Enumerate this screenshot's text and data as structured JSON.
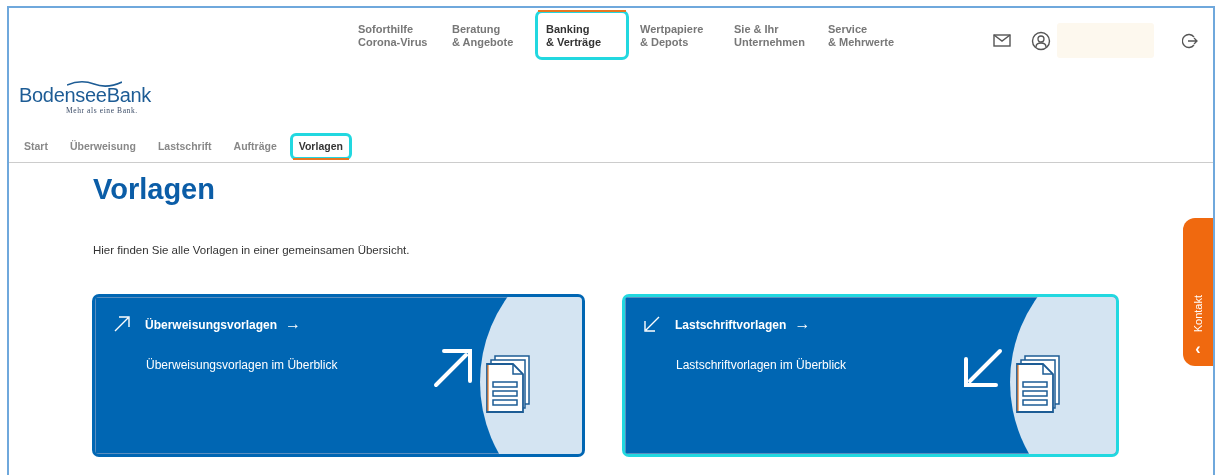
{
  "top_nav": [
    {
      "lines": [
        "Soforthilfe",
        "Corona-Virus"
      ],
      "selected": false,
      "highlighted": false
    },
    {
      "lines": [
        "Beratung",
        "& Angebote"
      ],
      "selected": false,
      "highlighted": false
    },
    {
      "lines": [
        "Banking",
        "& Verträge"
      ],
      "selected": true,
      "highlighted": true
    },
    {
      "lines": [
        "Wertpapiere",
        "& Depots"
      ],
      "selected": false,
      "highlighted": false
    },
    {
      "lines": [
        "Sie & Ihr",
        "Unternehmen"
      ],
      "selected": false,
      "highlighted": false
    },
    {
      "lines": [
        "Service",
        "& Mehrwerte"
      ],
      "selected": false,
      "highlighted": false
    }
  ],
  "logo": {
    "name": "BodenseeBank",
    "tagline": "Mehr als eine Bank."
  },
  "sub_nav": [
    {
      "label": "Start",
      "selected": false,
      "highlighted": false
    },
    {
      "label": "Überweisung",
      "selected": false,
      "highlighted": false
    },
    {
      "label": "Lastschrift",
      "selected": false,
      "highlighted": false
    },
    {
      "label": "Aufträge",
      "selected": false,
      "highlighted": false
    },
    {
      "label": "Vorlagen",
      "selected": true,
      "highlighted": true
    }
  ],
  "heading": "Vorlagen",
  "intro": "Hier finden Sie alle Vorlagen in einer gemeinsamen Übersicht.",
  "cards": [
    {
      "kind": "outgoing",
      "title": "Überweisungsvorlagen",
      "arrow": "→",
      "description": "Überweisungsvorlagen im Überblick",
      "highlighted": false
    },
    {
      "kind": "incoming",
      "title": "Lastschriftvorlagen",
      "arrow": "→",
      "description": "Lastschriftvorlagen im Überblick",
      "highlighted": true
    }
  ],
  "contact_tab": {
    "label": "Kontakt",
    "chevron": "‹"
  }
}
